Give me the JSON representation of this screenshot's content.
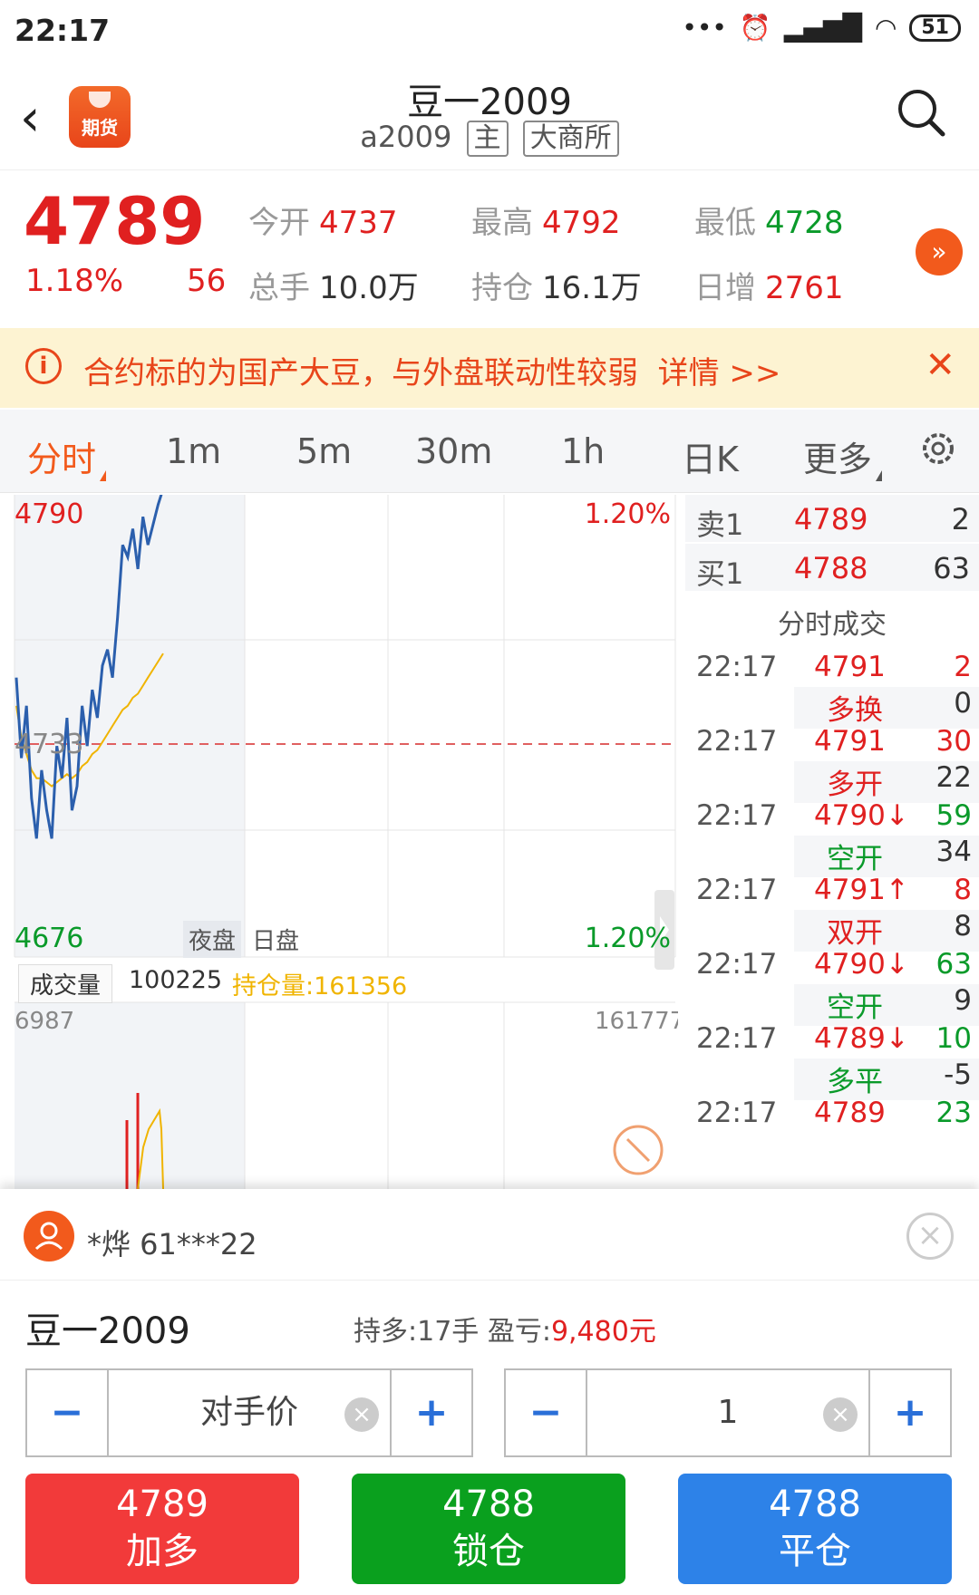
{
  "status": {
    "time": "22:17",
    "battery": "51"
  },
  "header": {
    "back_icon": "‹",
    "logo_text": "期货",
    "title": "豆一2009",
    "code": "a2009",
    "tag_main": "主",
    "tag_exchange": "大商所"
  },
  "quote": {
    "price": "4789",
    "change_pct": "1.18%",
    "change": "56",
    "open_label": "今开",
    "open": "4737",
    "high_label": "最高",
    "high": "4792",
    "low_label": "最低",
    "low": "4728",
    "volume_label": "总手",
    "volume": "10.0万",
    "oi_label": "持仓",
    "oi": "16.1万",
    "daily_label": "日增",
    "daily": "2761",
    "more_icon": "»"
  },
  "notice": {
    "icon": "i",
    "text": "合约标的为国产大豆，与外盘联动性较弱",
    "link": "详情 >>",
    "close": "✕"
  },
  "tabs": [
    "分时",
    "1m",
    "5m",
    "30m",
    "1h",
    "日K",
    "更多"
  ],
  "chart_labels": {
    "top_price": "4790",
    "top_pct": "1.20%",
    "mid_price": "4733",
    "bottom_price": "4676",
    "bottom_pct": "1.20%",
    "session_night": "夜盘",
    "session_day": "日盘",
    "vol_label": "成交量",
    "vol_value": "100225",
    "oi_label": "持仓量:161356",
    "vol_max": "6987",
    "oi_max": "161777"
  },
  "chart_data": {
    "type": "line",
    "series": [
      {
        "name": "price",
        "values": [
          4745,
          4725,
          4738,
          4715,
          4705,
          4722,
          4712,
          4705,
          4728,
          4720,
          4735,
          4712,
          4718,
          4738,
          4728,
          4742,
          4735,
          4748,
          4752,
          4745,
          4760,
          4778,
          4775,
          4782,
          4772,
          4785,
          4778,
          4783,
          4788,
          4792
        ]
      },
      {
        "name": "avg",
        "values": [
          4738,
          4730,
          4726,
          4722,
          4720,
          4720,
          4719,
          4718,
          4719,
          4720,
          4721,
          4720,
          4721,
          4723,
          4724,
          4726,
          4727,
          4729,
          4731,
          4733,
          4735,
          4737,
          4738,
          4740,
          4741,
          4743,
          4745,
          4747,
          4749,
          4751
        ]
      }
    ],
    "ylim": [
      4676,
      4790
    ]
  },
  "orderbook": {
    "sell_label": "卖1",
    "sell_price": "4789",
    "sell_qty": "2",
    "buy_label": "买1",
    "buy_price": "4788",
    "buy_qty": "63",
    "ticks_title": "分时成交",
    "ticks": [
      {
        "time": "22:17",
        "price": "4791",
        "vol": "2",
        "kind": "多换",
        "oi": "0",
        "color": "#e02020",
        "kcolor": "#e02020"
      },
      {
        "time": "22:17",
        "price": "4791",
        "vol": "30",
        "kind": "多开",
        "oi": "22",
        "color": "#e02020",
        "kcolor": "#e02020"
      },
      {
        "time": "22:17",
        "price": "4790↓",
        "vol": "59",
        "kind": "空开",
        "oi": "34",
        "color": "#0a9a2a",
        "kcolor": "#0a9a2a"
      },
      {
        "time": "22:17",
        "price": "4791↑",
        "vol": "8",
        "kind": "双开",
        "oi": "8",
        "color": "#e02020",
        "kcolor": "#e02020"
      },
      {
        "time": "22:17",
        "price": "4790↓",
        "vol": "63",
        "kind": "空开",
        "oi": "9",
        "color": "#0a9a2a",
        "kcolor": "#0a9a2a"
      },
      {
        "time": "22:17",
        "price": "4789↓",
        "vol": "10",
        "kind": "多平",
        "oi": "-5",
        "color": "#0a9a2a",
        "kcolor": "#0a9a2a"
      },
      {
        "time": "22:17",
        "price": "4789",
        "vol": "23",
        "kind": "",
        "oi": "",
        "color": "#0a9a2a",
        "kcolor": "#0a9a2a"
      }
    ]
  },
  "trade": {
    "user": "*烨  61***22",
    "product": "豆一2009",
    "position": "持多:17手  盈亏:",
    "pnl": "9,480元",
    "price_mode": "对手价",
    "qty": "1",
    "minus": "−",
    "plus": "+",
    "clear": "×",
    "buy_price": "4789",
    "buy_label": "加多",
    "lock_price": "4788",
    "lock_label": "锁仓",
    "close_price": "4788",
    "close_label": "平仓",
    "buy_color": "#f23a3a",
    "lock_color": "#0aa01e",
    "close_color": "#2d82e8"
  }
}
